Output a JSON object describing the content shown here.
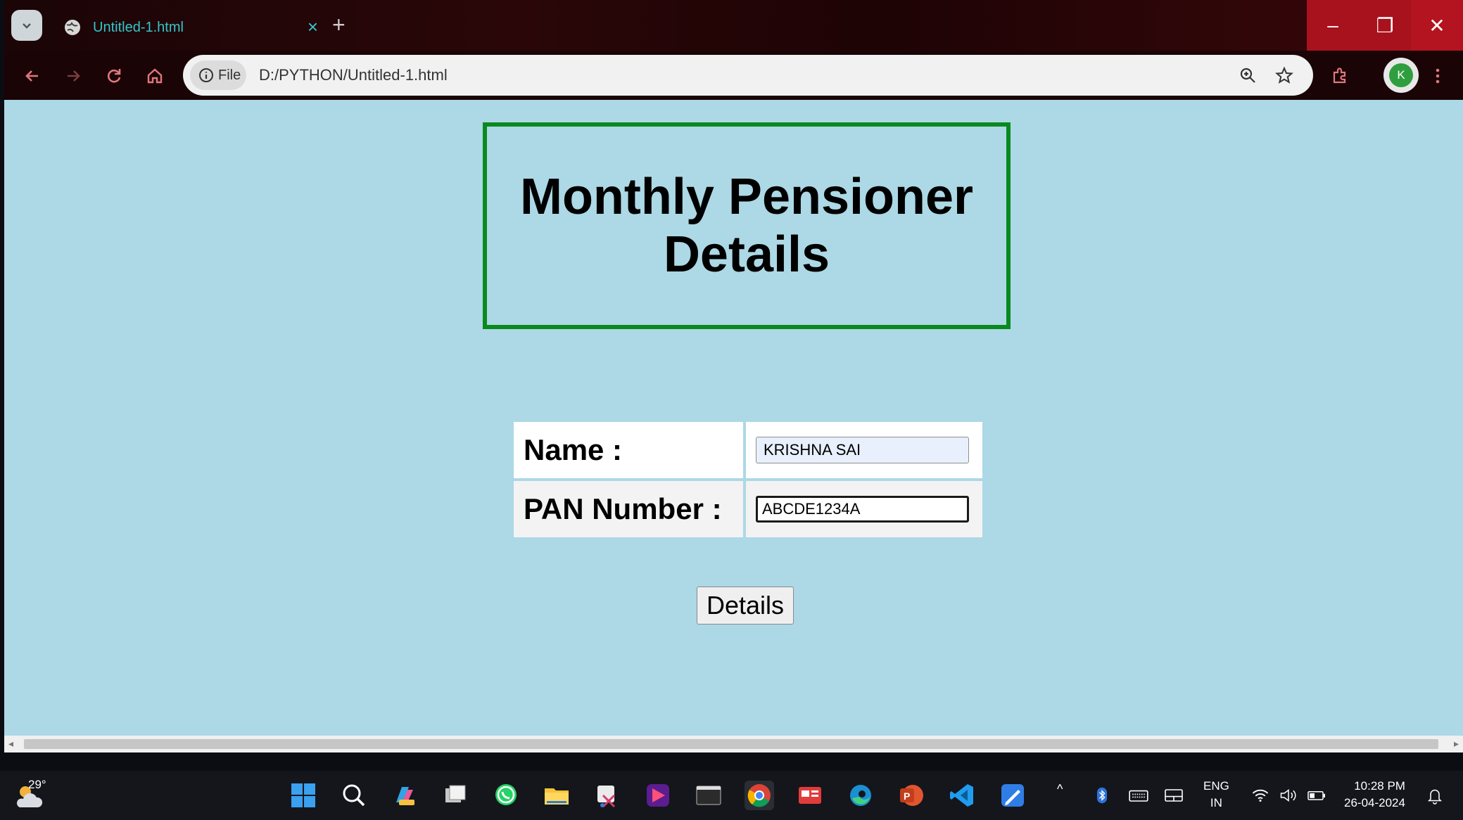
{
  "browser": {
    "tab_title": "Untitled-1.html",
    "tab_close": "×",
    "new_tab": "+",
    "info_label": "File",
    "url": "D:/PYTHON/Untitled-1.html",
    "profile_initial": "K",
    "window_buttons": {
      "minimize": "–",
      "restore": "❐",
      "close": "✕"
    }
  },
  "page": {
    "heading": "Monthly Pensioner Details",
    "form": {
      "name_label": "Name :",
      "name_value": "KRISHNA SAI",
      "pan_label": "PAN Number :",
      "pan_value": "ABCDE1234A"
    },
    "submit_label": "Details"
  },
  "taskbar": {
    "weather_temp": "29°",
    "lang_line1": "ENG",
    "lang_line2": "IN",
    "time": "10:28 PM",
    "date": "26-04-2024"
  },
  "colors": {
    "page_background": "#add8e6",
    "heading_border": "#0a8a1e",
    "tab_accent": "#35c6c9",
    "window_controls": "#b3141f"
  }
}
